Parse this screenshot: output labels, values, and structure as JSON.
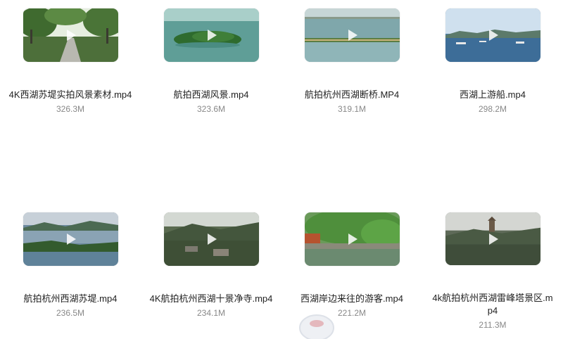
{
  "videos": [
    {
      "name": "4K西湖苏堤实拍风景素材.mp4",
      "size": "326.3M",
      "scene": "causeway"
    },
    {
      "name": "航拍西湖风景.mp4",
      "size": "323.6M",
      "scene": "island"
    },
    {
      "name": "航拍杭州西湖断桥.MP4",
      "size": "319.1M",
      "scene": "bridge"
    },
    {
      "name": "西湖上游船.mp4",
      "size": "298.2M",
      "scene": "boats"
    },
    {
      "name": "航拍杭州西湖苏堤.mp4",
      "size": "236.5M",
      "scene": "lake-hills"
    },
    {
      "name": "4K航拍杭州西湖十景净寺.mp4",
      "size": "234.1M",
      "scene": "temple"
    },
    {
      "name": "西湖岸边来往的游客.mp4",
      "size": "221.2M",
      "scene": "shore"
    },
    {
      "name": "4k航拍杭州西湖雷峰塔景区.mp4",
      "size": "211.3M",
      "scene": "pagoda"
    }
  ],
  "icons": {
    "play": "play-icon"
  }
}
